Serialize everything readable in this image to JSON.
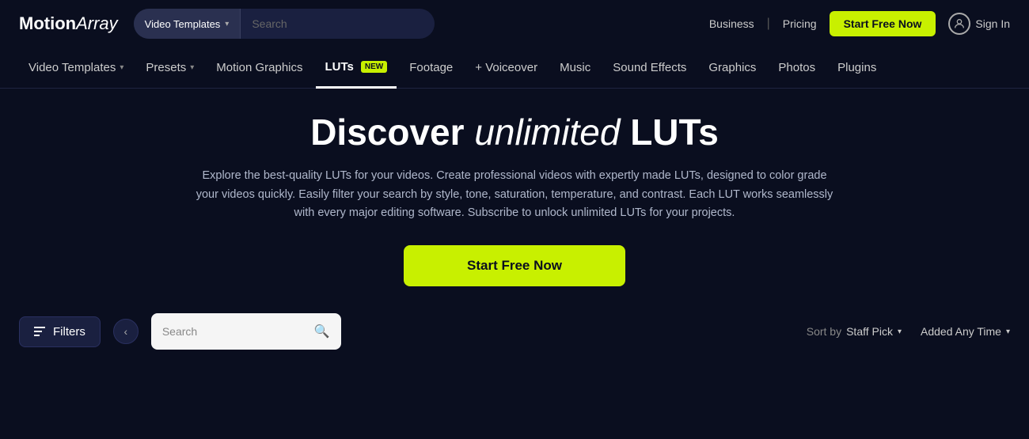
{
  "brand": {
    "name_regular": "Motion",
    "name_italic": "Array"
  },
  "topbar": {
    "search_dropdown_label": "Video Templates",
    "search_placeholder": "Search",
    "business_link": "Business",
    "pricing_link": "Pricing",
    "start_free_label": "Start Free Now",
    "sign_in_label": "Sign In"
  },
  "nav": {
    "items": [
      {
        "id": "video-templates",
        "label": "Video Templates",
        "has_dropdown": true,
        "active": false,
        "badge": null
      },
      {
        "id": "presets",
        "label": "Presets",
        "has_dropdown": true,
        "active": false,
        "badge": null
      },
      {
        "id": "motion-graphics",
        "label": "Motion Graphics",
        "has_dropdown": false,
        "active": false,
        "badge": null
      },
      {
        "id": "luts",
        "label": "LUTs",
        "has_dropdown": false,
        "active": true,
        "badge": "NEW"
      },
      {
        "id": "footage",
        "label": "Footage",
        "has_dropdown": false,
        "active": false,
        "badge": null
      },
      {
        "id": "voiceover",
        "label": "+ Voiceover",
        "has_dropdown": false,
        "active": false,
        "badge": null
      },
      {
        "id": "music",
        "label": "Music",
        "has_dropdown": false,
        "active": false,
        "badge": null
      },
      {
        "id": "sound-effects",
        "label": "Sound Effects",
        "has_dropdown": false,
        "active": false,
        "badge": null
      },
      {
        "id": "graphics",
        "label": "Graphics",
        "has_dropdown": false,
        "active": false,
        "badge": null
      },
      {
        "id": "photos",
        "label": "Photos",
        "has_dropdown": false,
        "active": false,
        "badge": null
      },
      {
        "id": "plugins",
        "label": "Plugins",
        "has_dropdown": false,
        "active": false,
        "badge": null
      }
    ]
  },
  "hero": {
    "title_normal": "Discover ",
    "title_italic": "unlimited",
    "title_end": " LUTs",
    "description": "Explore the best-quality LUTs for your videos. Create professional videos with expertly made LUTs, designed to color grade your videos quickly. Easily filter your search by style, tone, saturation, temperature, and contrast. Each LUT works seamlessly with every major editing software. Subscribe to unlock unlimited LUTs for your projects.",
    "cta_label": "Start Free Now"
  },
  "filters": {
    "filters_label": "Filters",
    "search_placeholder": "Search",
    "sort_prefix": "Sort by",
    "sort_value": "Staff Pick",
    "added_label": "Added Any Time"
  }
}
